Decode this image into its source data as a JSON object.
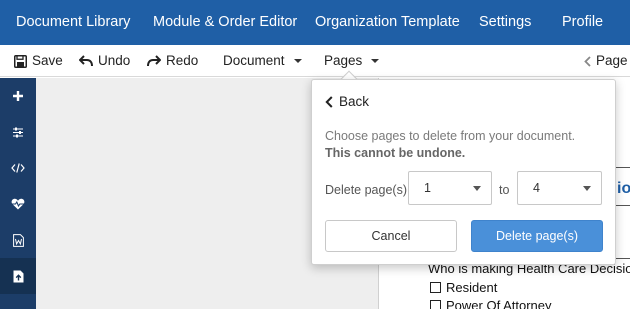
{
  "topnav": {
    "items": [
      "Document Library",
      "Module & Order Editor",
      "Organization Template",
      "Settings",
      "Profile"
    ]
  },
  "toolbar": {
    "save_label": "Save",
    "undo_label": "Undo",
    "redo_label": "Redo",
    "document_label": "Document",
    "pages_label": "Pages",
    "page_nav_label": "Page"
  },
  "sidebar": {
    "icons": [
      "plus-icon",
      "sliders-icon",
      "code-icon",
      "heartbeat-icon",
      "word-file-icon",
      "file-upload-icon"
    ]
  },
  "popup": {
    "back_label": "Back",
    "message": "Choose pages to delete from your document.",
    "warning": "This cannot be undone.",
    "range_label": "Delete page(s)",
    "from_value": "1",
    "to_label": "to",
    "to_value": "4",
    "cancel_label": "Cancel",
    "delete_label": "Delete page(s)"
  },
  "document": {
    "heading_fragment": "io",
    "question": "Who is making Health Care Decisio",
    "options": [
      "Resident",
      "Power Of Attorney"
    ]
  },
  "colors": {
    "nav_bg": "#1f5fa6",
    "sidebar_bg": "#1c3d68",
    "primary_button": "#4a90d9"
  }
}
